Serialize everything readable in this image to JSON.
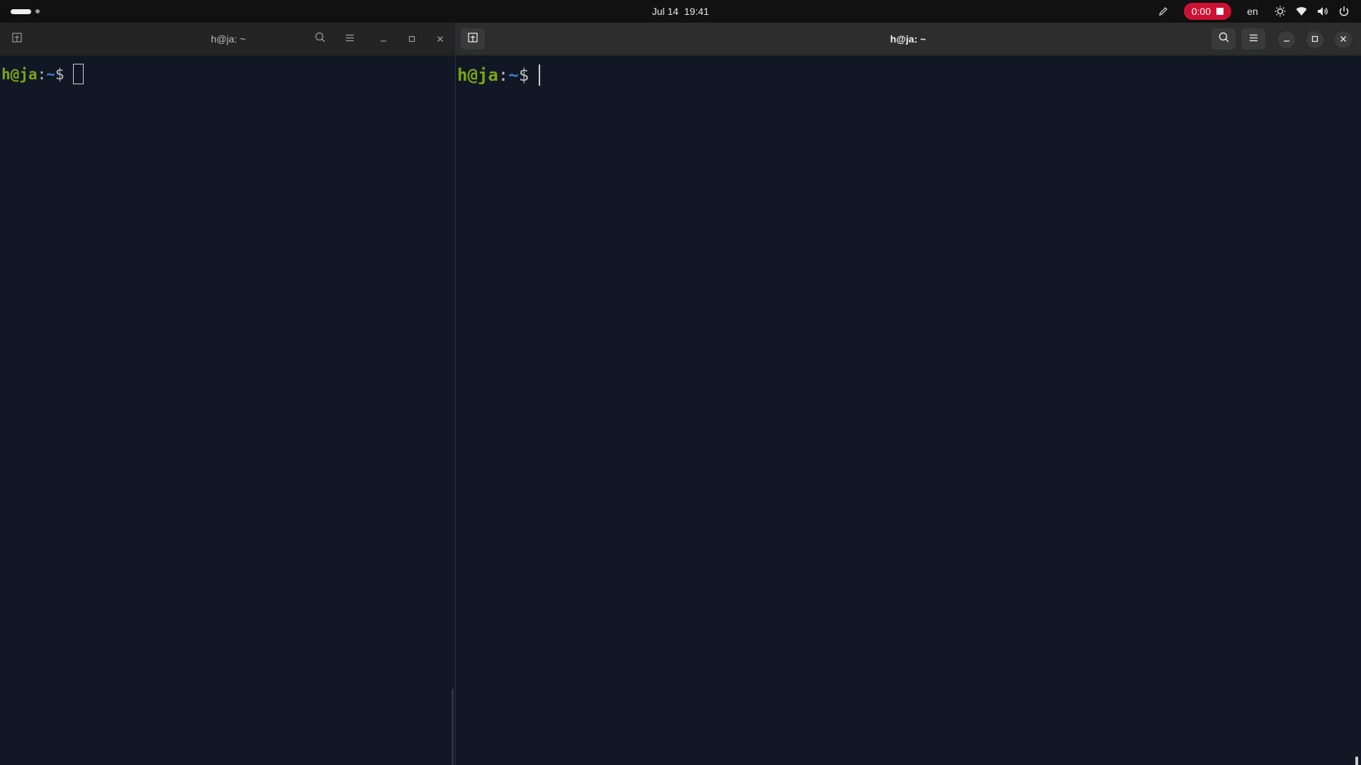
{
  "topbar": {
    "date": "Jul 14",
    "time": "19:41",
    "recording_time": "0:00",
    "language": "en",
    "record_color": "#cc1133"
  },
  "left_terminal": {
    "title": "h@ja: ~",
    "prompt_user": "h@ja",
    "prompt_sep": ":",
    "prompt_path": "~",
    "prompt_symbol": "$"
  },
  "right_terminal": {
    "title": "h@ja: ~",
    "prompt_user": "h@ja",
    "prompt_sep": ":",
    "prompt_path": "~",
    "prompt_symbol": "$"
  },
  "colors": {
    "background": "#101826",
    "prompt_user": "#7aa514",
    "prompt_path": "#3f7fd0"
  },
  "icons": [
    "activities-icon",
    "pen-icon",
    "stop-icon",
    "brightness-icon",
    "wifi-icon",
    "volume-icon",
    "power-icon",
    "new-tab-icon",
    "search-icon",
    "menu-icon",
    "minimize-icon",
    "maximize-icon",
    "close-icon"
  ]
}
